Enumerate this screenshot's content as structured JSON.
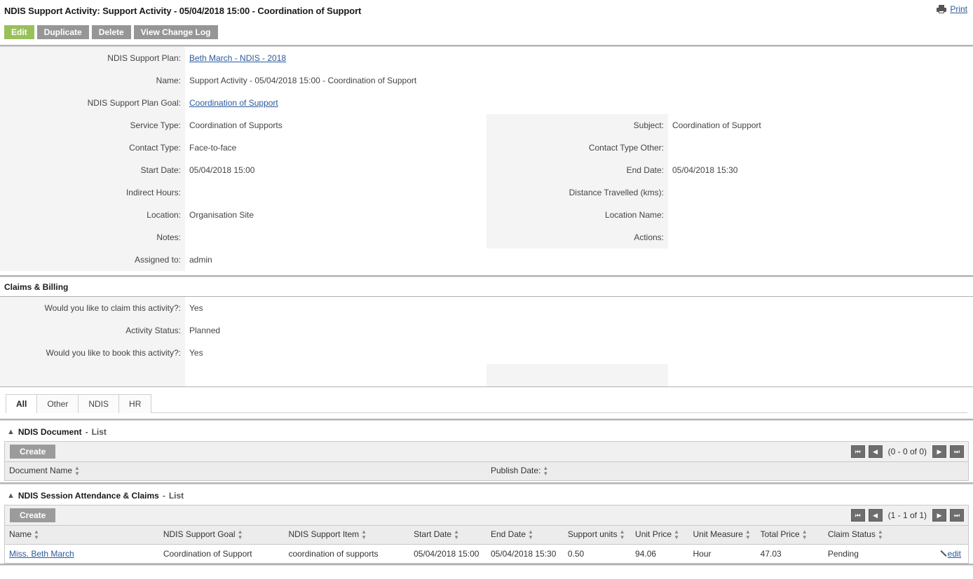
{
  "header": {
    "title": "NDIS Support Activity: Support Activity - 05/04/2018 15:00 - Coordination of Support",
    "print_label": "Print",
    "print_icon": "printer-icon"
  },
  "actions": {
    "edit": "Edit",
    "duplicate": "Duplicate",
    "delete": "Delete",
    "view_change_log": "View Change Log",
    "edit_color": "#9ac05a",
    "default_color": "#969696"
  },
  "details": {
    "left": [
      {
        "label": "NDIS Support Plan:",
        "value": "Beth March - NDIS - 2018",
        "link": true
      },
      {
        "label": "Name:",
        "value": "Support Activity - 05/04/2018 15:00 - Coordination of Support",
        "link": false
      },
      {
        "label": "NDIS Support Plan Goal:",
        "value": "Coordination of Support",
        "link": true
      },
      {
        "label": "Service Type:",
        "value": "Coordination of Supports",
        "link": false
      },
      {
        "label": "Contact Type:",
        "value": "Face-to-face",
        "link": false
      },
      {
        "label": "Start Date:",
        "value": "05/04/2018 15:00",
        "link": false
      },
      {
        "label": "Indirect Hours:",
        "value": "",
        "link": false
      },
      {
        "label": "Location:",
        "value": "Organisation Site",
        "link": false
      },
      {
        "label": "Notes:",
        "value": "",
        "link": false
      },
      {
        "label": "Assigned to:",
        "value": "admin",
        "link": false
      }
    ],
    "right": [
      {
        "label": "Subject:",
        "value": "Coordination of Support"
      },
      {
        "label": "Contact Type Other:",
        "value": ""
      },
      {
        "label": "End Date:",
        "value": "05/04/2018 15:30"
      },
      {
        "label": "Distance Travelled (kms):",
        "value": ""
      },
      {
        "label": "Location Name:",
        "value": ""
      },
      {
        "label": "Actions:",
        "value": ""
      }
    ]
  },
  "claims": {
    "section_title": "Claims & Billing",
    "rows": [
      {
        "label": "Would you like to claim this activity?:",
        "value": "Yes"
      },
      {
        "label": "Activity Status:",
        "value": "Planned"
      },
      {
        "label": "Would you like to book this activity?:",
        "value": "Yes"
      }
    ]
  },
  "tabs": [
    {
      "label": "All",
      "active": true
    },
    {
      "label": "Other",
      "active": false
    },
    {
      "label": "NDIS",
      "active": false
    },
    {
      "label": "HR",
      "active": false
    }
  ],
  "documents_panel": {
    "collapse_icon": "chevron-up-icon",
    "title": "NDIS Document",
    "separator": "-",
    "subtitle": "List",
    "create_label": "Create",
    "pager": {
      "first_icon": "first-page-icon",
      "prev_icon": "previous-page-icon",
      "count": "(0 - 0 of 0)",
      "next_icon": "next-page-icon",
      "last_icon": "last-page-icon"
    },
    "columns": [
      "Document Name",
      "Publish Date:"
    ],
    "rows": []
  },
  "sessions_panel": {
    "collapse_icon": "chevron-up-icon",
    "title": "NDIS Session Attendance & Claims",
    "separator": "-",
    "subtitle": "List",
    "create_label": "Create",
    "pager": {
      "first_icon": "first-page-icon",
      "prev_icon": "previous-page-icon",
      "count": "(1 - 1 of 1)",
      "next_icon": "next-page-icon",
      "last_icon": "last-page-icon"
    },
    "columns": [
      "Name",
      "NDIS Support Goal",
      "NDIS Support Item",
      "Start Date",
      "End Date",
      "Support units",
      "Unit Price",
      "Unit Measure",
      "Total Price",
      "Claim Status"
    ],
    "row": {
      "name": "Miss. Beth March",
      "support_goal": "Coordination of Support",
      "support_item": "coordination of supports",
      "start_date": "05/04/2018 15:00",
      "end_date": "05/04/2018 15:30",
      "support_units": "0.50",
      "unit_price": "94.06",
      "unit_measure": "Hour",
      "total_price": "47.03",
      "claim_status": "Pending",
      "edit_label": "edit",
      "edit_icon": "pencil-icon"
    }
  },
  "colors": {
    "label_bg": "#f4f4f4",
    "link": "#2b5a9b",
    "accent_green": "#9ac05a"
  }
}
